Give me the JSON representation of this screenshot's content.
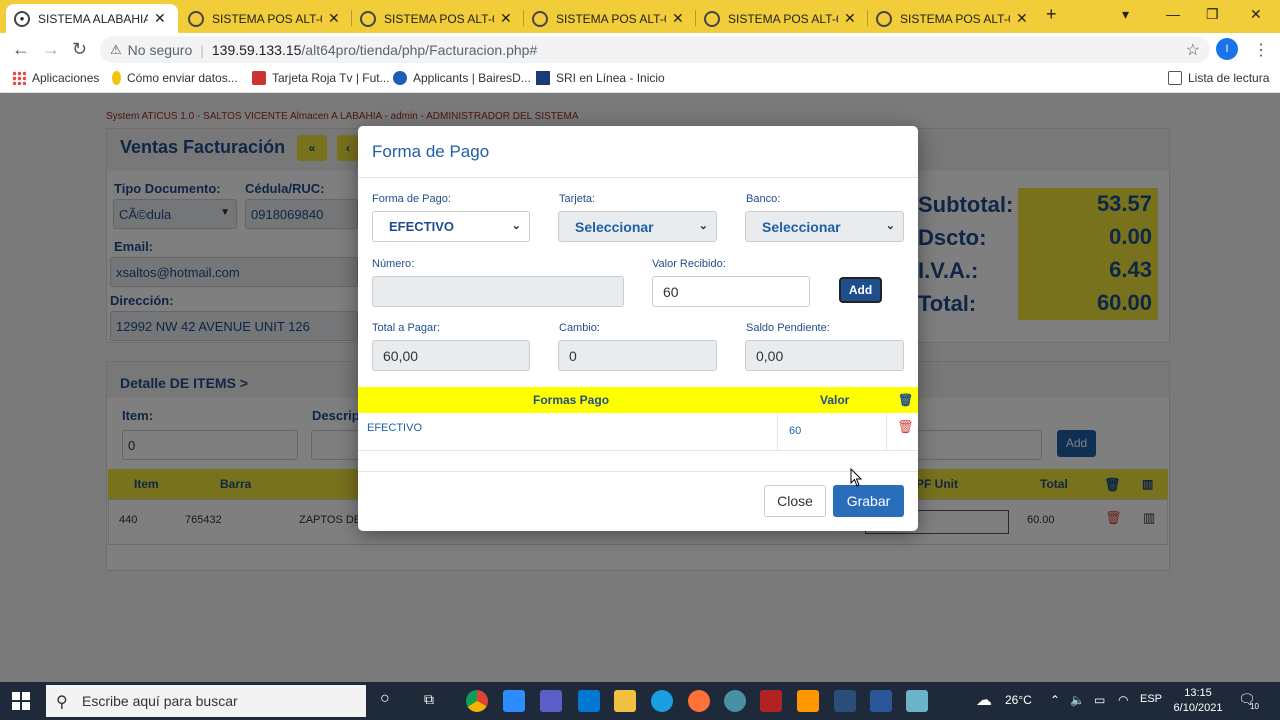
{
  "browser": {
    "tabs": [
      {
        "title": "SISTEMA ALABAHIA.C",
        "active": true
      },
      {
        "title": "SISTEMA POS ALT-64",
        "active": false
      },
      {
        "title": "SISTEMA POS ALT-64",
        "active": false
      },
      {
        "title": "SISTEMA POS ALT-64",
        "active": false
      },
      {
        "title": "SISTEMA POS ALT-64",
        "active": false
      },
      {
        "title": "SISTEMA POS ALT-64",
        "active": false
      }
    ],
    "new_tab": "+",
    "address": {
      "security": "No seguro",
      "host": "139.59.133.15",
      "path": "/alt64pro/tienda/php/Facturacion.php#"
    },
    "profile_initial": "I",
    "bookmarks": [
      {
        "label": "Aplicaciones"
      },
      {
        "label": "Cómo enviar datos..."
      },
      {
        "label": "Tarjeta Roja Tv | Fut..."
      },
      {
        "label": "Applicants | BairesD..."
      },
      {
        "label": "SRI en Línea - Inicio"
      }
    ],
    "reading_list": "Lista de lectura"
  },
  "app": {
    "system_info": "System ATICUS 1.0 - SALTOS VICENTE Almacen   A LABAHIA - admin - ADMINISTRADOR DEL SISTEMA",
    "title": "Ventas Facturación",
    "nav_first": "«",
    "nav_prev": "‹",
    "tipo_documento_label": "Tipo Documento:",
    "tipo_documento_value": "CÃ©dula",
    "cedula_label": "Cédula/RUC:",
    "cedula_value": "0918069840",
    "email_label": "Email:",
    "email_value": "xsaltos@hotmail.com",
    "direccion_label": "Dirección:",
    "direccion_value": "12992 NW 42 AVENUE UNIT 126",
    "totals": [
      {
        "label": "Subtotal:",
        "value": "53.57"
      },
      {
        "label": "Dscto:",
        "value": "0.00"
      },
      {
        "label": "I.V.A.:",
        "value": "6.43"
      },
      {
        "label": "Total:",
        "value": "60.00"
      }
    ],
    "detalle_title": "Detalle DE ITEMS >",
    "item_label": "Item:",
    "item_value": "0",
    "descripcion_label": "Descrip",
    "add_label": "Add",
    "grid_headers": {
      "item": "Item",
      "barra": "Barra",
      "pf_unit": "PF Unit",
      "total": "Total"
    },
    "grid_rows": [
      {
        "item": "440",
        "barra": "765432",
        "descripcion": "ZAPTOS DE",
        "total": "60.00"
      }
    ]
  },
  "modal": {
    "title": "Forma de Pago",
    "forma_pago_label": "Forma de Pago:",
    "forma_pago_value": "EFECTIVO",
    "tarjeta_label": "Tarjeta:",
    "tarjeta_value": "Seleccionar",
    "banco_label": "Banco:",
    "banco_value": "Seleccionar",
    "numero_label": "Número:",
    "numero_value": "",
    "valor_recibido_label": "Valor Recibido:",
    "valor_recibido_value": "60",
    "add_label": "Add",
    "total_pagar_label": "Total a Pagar:",
    "total_pagar_value": "60,00",
    "cambio_label": "Cambio:",
    "cambio_value": "0",
    "saldo_label": "Saldo Pendiente:",
    "saldo_value": "0,00",
    "grid_headers": {
      "formas": "Formas Pago",
      "valor": "Valor"
    },
    "rows": [
      {
        "forma": "EFECTIVO",
        "valor": "60"
      }
    ],
    "close_label": "Close",
    "grabar_label": "Grabar"
  },
  "taskbar": {
    "search_placeholder": "Escribe aquí para buscar",
    "temperature": "26°C",
    "language": "ESP",
    "time": "13:15",
    "date": "6/10/2021",
    "notifications": "10"
  },
  "colors": {
    "tabstrip": "#f2cd3a",
    "accent_blue": "#1f4e8c",
    "highlight_yellow": "#ffff00",
    "grabar_blue": "#2a6ebb"
  }
}
